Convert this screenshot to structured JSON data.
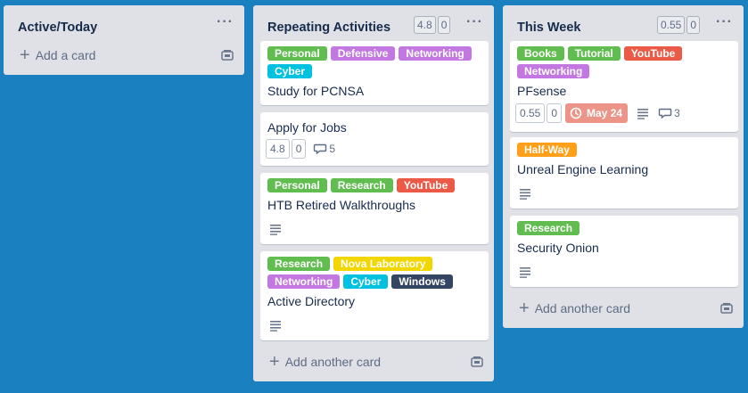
{
  "colors": {
    "board_bg": "#1a80c0",
    "list_bg": "#dfe1e6",
    "label_green": "#61bd4f",
    "label_purple": "#c377e0",
    "label_sky": "#00c2e0",
    "label_red": "#eb5a46",
    "label_orange": "#ff9f1a",
    "label_yellow": "#f2d600",
    "label_black": "#344563",
    "due_overdue": "#ec9488"
  },
  "lists": [
    {
      "title": "Active/Today",
      "menu": "···",
      "add_label": "Add a card",
      "cards": []
    },
    {
      "title": "Repeating Activities",
      "menu": "···",
      "header_badges": [
        "4.8",
        "0"
      ],
      "add_label": "Add another card",
      "cards": [
        {
          "labels": [
            {
              "text": "Personal",
              "color": "green"
            },
            {
              "text": "Defensive",
              "color": "purple"
            },
            {
              "text": "Networking",
              "color": "purple"
            },
            {
              "text": "Cyber",
              "color": "sky"
            }
          ],
          "title": "Study for PCNSA"
        },
        {
          "labels": [],
          "title": "Apply for Jobs",
          "badges": [
            "4.8",
            "0"
          ],
          "comments": "5"
        },
        {
          "labels": [
            {
              "text": "Personal",
              "color": "green"
            },
            {
              "text": "Research",
              "color": "green"
            },
            {
              "text": "YouTube",
              "color": "red"
            }
          ],
          "title": "HTB Retired Walkthroughs",
          "description_icon": "description-icon"
        },
        {
          "labels": [
            {
              "text": "Research",
              "color": "green"
            },
            {
              "text": "Nova Laboratory",
              "color": "yellow"
            },
            {
              "text": "Networking",
              "color": "purple"
            },
            {
              "text": "Cyber",
              "color": "sky"
            },
            {
              "text": "Windows",
              "color": "black"
            }
          ],
          "title": "Active Directory",
          "description_icon": "description-icon"
        }
      ]
    },
    {
      "title": "This Week",
      "menu": "···",
      "header_badges": [
        "0.55",
        "0"
      ],
      "add_label": "Add another card",
      "cards": [
        {
          "labels": [
            {
              "text": "Books",
              "color": "green"
            },
            {
              "text": "Tutorial",
              "color": "green"
            },
            {
              "text": "YouTube",
              "color": "red"
            },
            {
              "text": "Networking",
              "color": "purple"
            }
          ],
          "title": "PFsense",
          "badges": [
            "0.55",
            "0"
          ],
          "due": "May 24",
          "comments": "3"
        },
        {
          "labels": [
            {
              "text": "Half-Way",
              "color": "orange"
            }
          ],
          "title": "Unreal Engine Learning",
          "description_icon": "description-icon"
        },
        {
          "labels": [
            {
              "text": "Research",
              "color": "green"
            }
          ],
          "title": "Security Onion",
          "description_icon": "description-icon"
        }
      ]
    }
  ]
}
